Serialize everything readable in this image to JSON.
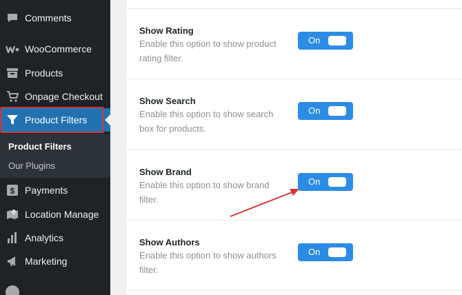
{
  "sidebar": {
    "items": [
      {
        "label": "Comments",
        "icon": "comment-icon"
      },
      {
        "label": "WooCommerce",
        "icon": "woocommerce-icon"
      },
      {
        "label": "Products",
        "icon": "archive-icon"
      },
      {
        "label": "Onpage Checkout",
        "icon": "cart-icon"
      },
      {
        "label": "Product Filters",
        "icon": "filter-icon"
      },
      {
        "label": "Payments",
        "icon": "dollar-icon"
      },
      {
        "label": "Location Manage",
        "icon": "location-icon"
      },
      {
        "label": "Analytics",
        "icon": "bar-chart-icon"
      },
      {
        "label": "Marketing",
        "icon": "megaphone-icon"
      }
    ],
    "submenu": [
      {
        "label": "Product Filters"
      },
      {
        "label": "Our Plugins"
      }
    ]
  },
  "settings": [
    {
      "title": "Show Rating",
      "description": "Enable this option to show product rating filter.",
      "toggle": "On"
    },
    {
      "title": "Show Search",
      "description": "Enable this option to show search box for products.",
      "toggle": "On"
    },
    {
      "title": "Show Brand",
      "description": "Enable this option to show brand filter.",
      "toggle": "On"
    },
    {
      "title": "Show Authors",
      "description": "Enable this option to show authors filter.",
      "toggle": "On"
    }
  ],
  "colors": {
    "accent": "#2271b1",
    "toggle": "#2b8ce6",
    "highlight": "#d63638"
  }
}
